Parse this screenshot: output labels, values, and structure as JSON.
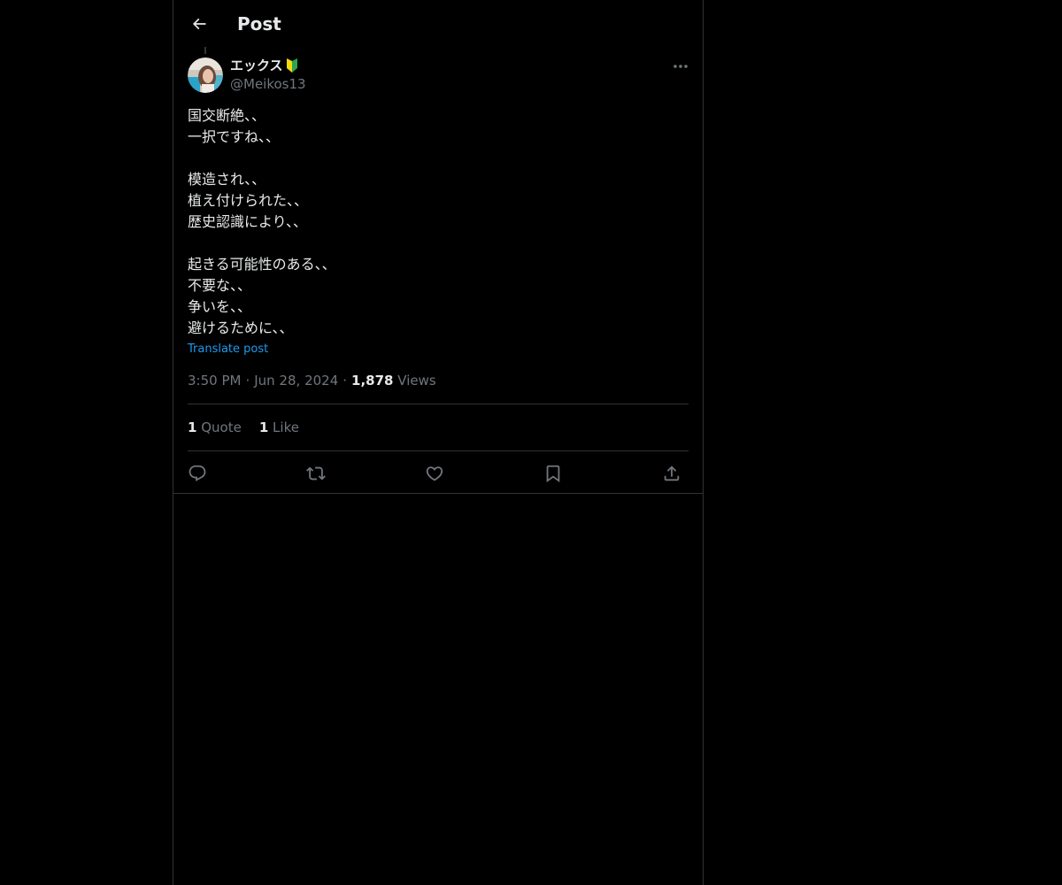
{
  "header": {
    "title": "Post",
    "back_icon": "arrow-left-icon"
  },
  "author": {
    "display_name": "エックス",
    "badge_emoji": "🔰",
    "handle": "@Meikos13",
    "avatar_icon": "avatar-image"
  },
  "post": {
    "lines": [
      "国交断絶、、",
      "一択ですね、、",
      "",
      "模造され、、",
      "植え付けられた、、",
      "歴史認識により、、",
      "",
      "起きる可能性のある、、",
      "不要な、、",
      "争いを、、",
      "避けるために、、"
    ],
    "translate_label": "Translate post"
  },
  "meta": {
    "time": "3:50 PM",
    "date": "Jun 28, 2024",
    "separator": "·",
    "views_count": "1,878",
    "views_label": "Views"
  },
  "stats": {
    "quote_count": "1",
    "quote_label": "Quote",
    "like_count": "1",
    "like_label": "Like"
  },
  "actions": [
    {
      "name": "reply",
      "icon": "reply-icon"
    },
    {
      "name": "repost",
      "icon": "repost-icon"
    },
    {
      "name": "like",
      "icon": "heart-icon"
    },
    {
      "name": "bookmark",
      "icon": "bookmark-icon"
    },
    {
      "name": "share",
      "icon": "share-icon"
    }
  ],
  "colors": {
    "background": "#000000",
    "text_primary": "#e7e9ea",
    "text_secondary": "#71767b",
    "link": "#1d9bf0",
    "border": "#2f3336"
  }
}
